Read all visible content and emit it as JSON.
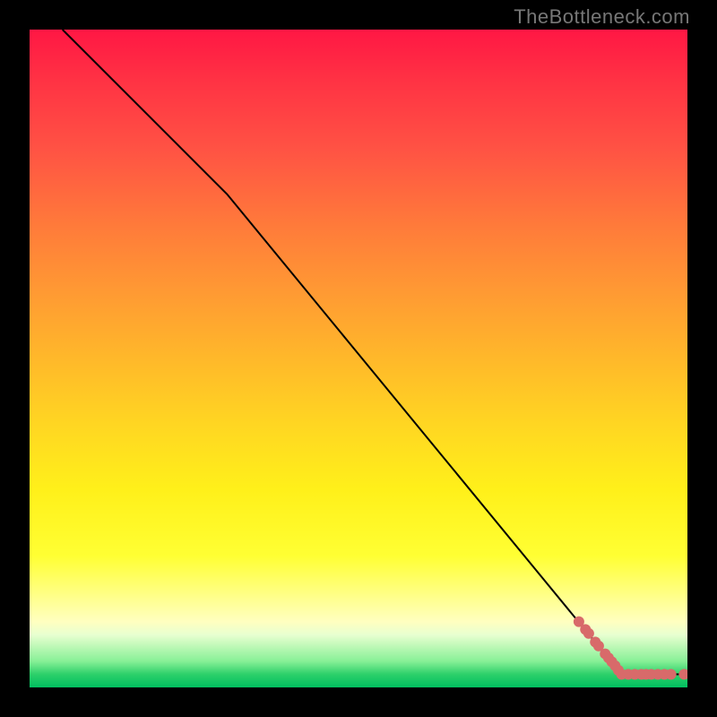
{
  "watermark": "TheBottleneck.com",
  "chart_data": {
    "type": "line",
    "title": "",
    "xlabel": "",
    "ylabel": "",
    "xlim": [
      0,
      100
    ],
    "ylim": [
      0,
      100
    ],
    "line": {
      "name": "curve",
      "points": [
        {
          "x": 5,
          "y": 100
        },
        {
          "x": 30,
          "y": 75
        },
        {
          "x": 90,
          "y": 2
        },
        {
          "x": 100,
          "y": 2
        }
      ]
    },
    "markers": {
      "name": "highlighted-points",
      "color": "#d86a6a",
      "radius": 6,
      "points": [
        {
          "x": 83.5,
          "y": 10.0
        },
        {
          "x": 84.5,
          "y": 8.8
        },
        {
          "x": 85.0,
          "y": 8.2
        },
        {
          "x": 86.0,
          "y": 6.9
        },
        {
          "x": 86.5,
          "y": 6.3
        },
        {
          "x": 87.5,
          "y": 5.1
        },
        {
          "x": 88.0,
          "y": 4.5
        },
        {
          "x": 88.5,
          "y": 3.9
        },
        {
          "x": 89.0,
          "y": 3.3
        },
        {
          "x": 89.5,
          "y": 2.6
        },
        {
          "x": 90.0,
          "y": 2.0
        },
        {
          "x": 91.0,
          "y": 2.0
        },
        {
          "x": 92.0,
          "y": 2.0
        },
        {
          "x": 93.0,
          "y": 2.0
        },
        {
          "x": 93.7,
          "y": 2.0
        },
        {
          "x": 94.5,
          "y": 2.0
        },
        {
          "x": 95.5,
          "y": 2.0
        },
        {
          "x": 96.5,
          "y": 2.0
        },
        {
          "x": 97.5,
          "y": 2.0
        },
        {
          "x": 99.5,
          "y": 2.0
        }
      ]
    },
    "background": {
      "type": "vertical-gradient",
      "stops": [
        {
          "pos": 0.0,
          "color": "#ff1744"
        },
        {
          "pos": 0.5,
          "color": "#ffd622"
        },
        {
          "pos": 0.9,
          "color": "#ffffc0"
        },
        {
          "pos": 1.0,
          "color": "#00c060"
        }
      ]
    }
  }
}
